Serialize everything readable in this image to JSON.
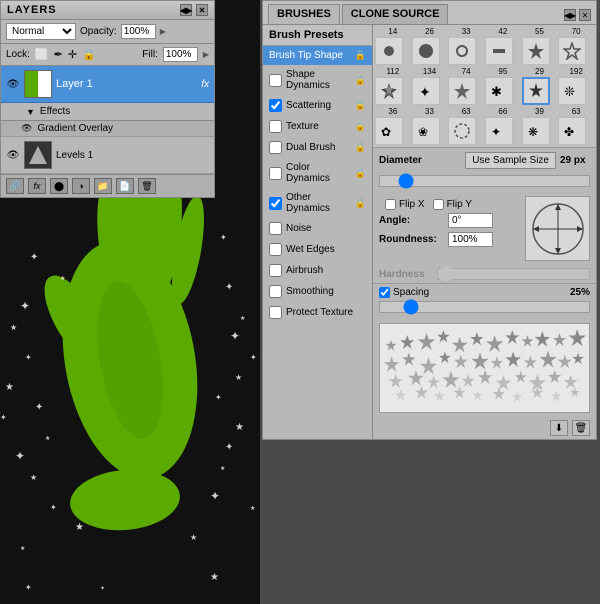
{
  "canvas": {
    "background": "#000"
  },
  "layers_panel": {
    "title": "LAYERS",
    "collapse_btn": "◀▶",
    "close_btn": "✕",
    "blend_mode": "Normal",
    "opacity_label": "Opacity:",
    "opacity_value": "100%",
    "lock_label": "Lock:",
    "fill_label": "Fill:",
    "fill_value": "100%",
    "layer_name": "Layer 1",
    "fx_label": "fx",
    "effects_label": "Effects",
    "gradient_overlay": "Gradient Overlay",
    "levels_name": "Levels 1",
    "bottom_buttons": [
      "link",
      "fx",
      "new-adj",
      "new-group",
      "new-layer",
      "delete"
    ]
  },
  "brushes_panel": {
    "title": "BRUSHES",
    "clone_source_tab": "CLONE SOURCE",
    "collapse_btn": "◀▶",
    "presets_header": "Brush Presets",
    "preset_items": [
      {
        "label": "Brush Tip Shape",
        "active": true,
        "checked": false
      },
      {
        "label": "Shape Dynamics",
        "active": false,
        "checked": false
      },
      {
        "label": "Scattering",
        "active": false,
        "checked": true
      },
      {
        "label": "Texture",
        "active": false,
        "checked": false
      },
      {
        "label": "Dual Brush",
        "active": false,
        "checked": false
      },
      {
        "label": "Color Dynamics",
        "active": false,
        "checked": false
      },
      {
        "label": "Other Dynamics",
        "active": false,
        "checked": true
      },
      {
        "label": "Noise",
        "active": false,
        "checked": false
      },
      {
        "label": "Wet Edges",
        "active": false,
        "checked": false
      },
      {
        "label": "Airbrush",
        "active": false,
        "checked": false
      },
      {
        "label": "Smoothing",
        "active": false,
        "checked": false
      },
      {
        "label": "Protect Texture",
        "active": false,
        "checked": false
      }
    ],
    "tip_sizes_row1": [
      "14",
      "26",
      "33",
      "42",
      "55",
      "70"
    ],
    "tip_sizes_row2": [
      "112",
      "134",
      "74",
      "95",
      "29",
      "192"
    ],
    "tip_sizes_row3": [
      "36",
      "33",
      "63",
      "66",
      "39",
      "63"
    ],
    "diameter_label": "Diameter",
    "use_sample_btn": "Use Sample Size",
    "diameter_value": "29 px",
    "flip_x_label": "Flip X",
    "flip_y_label": "Flip Y",
    "angle_label": "Angle:",
    "angle_value": "0°",
    "roundness_label": "Roundness:",
    "roundness_value": "100%",
    "hardness_label": "Hardness",
    "spacing_label": "Spacing",
    "spacing_value": "25%"
  }
}
